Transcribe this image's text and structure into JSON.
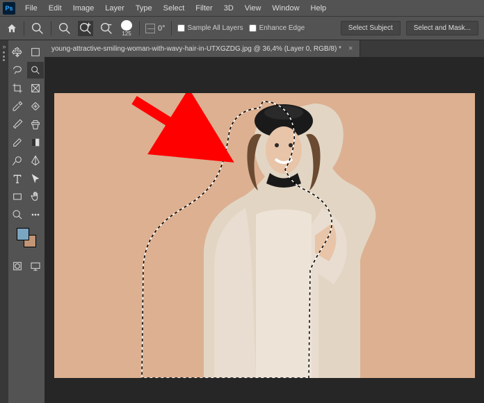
{
  "menubar": {
    "items": [
      "File",
      "Edit",
      "Image",
      "Layer",
      "Type",
      "Select",
      "Filter",
      "3D",
      "View",
      "Window",
      "Help"
    ]
  },
  "optionsbar": {
    "brush_size": "125",
    "angle_label": "0°",
    "sample_all_label": "Sample All Layers",
    "enhance_edge_label": "Enhance Edge",
    "select_subject_label": "Select Subject",
    "select_mask_label": "Select and Mask..."
  },
  "tab": {
    "label": "young-attractive-smiling-woman-with-wavy-hair-in-UTXGZDG.jpg @ 36,4% (Layer 0, RGB/8) *"
  },
  "swatch": {
    "foreground": "#7aa6c2",
    "background": "#c19575"
  },
  "canvas": {
    "background_color": "#dcb091"
  },
  "annotation": {
    "arrow_color": "#ff0000"
  }
}
